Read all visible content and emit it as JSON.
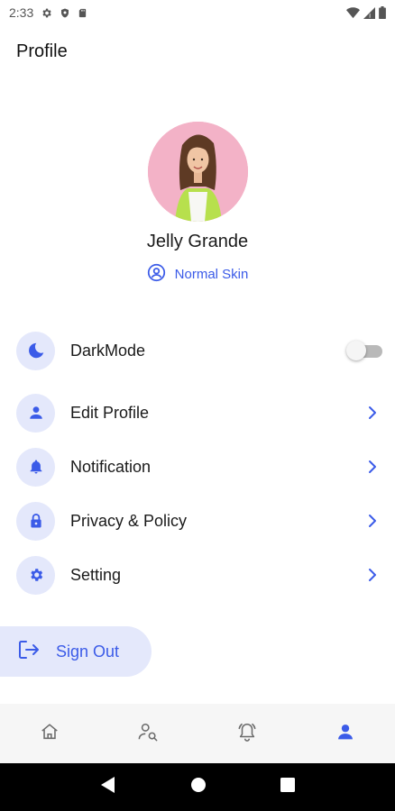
{
  "status_bar": {
    "time": "2:33"
  },
  "header": {
    "title": "Profile"
  },
  "profile": {
    "name": "Jelly Grande",
    "skin_type": "Normal Skin"
  },
  "menu": [
    {
      "id": "darkmode",
      "label": "DarkMode",
      "icon": "moon-icon",
      "control": "toggle",
      "toggle_on": false
    },
    {
      "id": "edit-profile",
      "label": "Edit Profile",
      "icon": "person-icon",
      "control": "chevron"
    },
    {
      "id": "notification",
      "label": "Notification",
      "icon": "bell-icon",
      "control": "chevron"
    },
    {
      "id": "privacy",
      "label": "Privacy & Policy",
      "icon": "lock-icon",
      "control": "chevron"
    },
    {
      "id": "setting",
      "label": "Setting",
      "icon": "gear-icon",
      "control": "chevron"
    }
  ],
  "sign_out": {
    "label": "Sign Out",
    "icon": "logout-icon"
  },
  "bottom_nav": [
    {
      "icon": "home-icon",
      "active": false
    },
    {
      "icon": "person-search-icon",
      "active": false
    },
    {
      "icon": "alarm-bell-icon",
      "active": false
    },
    {
      "icon": "profile-icon",
      "active": true
    }
  ],
  "colors": {
    "accent": "#3b5be8",
    "icon_bg": "#e4e8fb",
    "nav_bg": "#f6f6f6",
    "inactive_icon": "#6b6b6b"
  }
}
